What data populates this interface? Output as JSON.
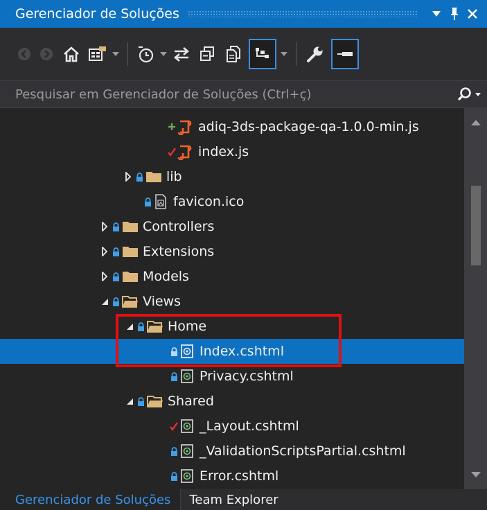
{
  "window": {
    "title": "Gerenciador de Soluções"
  },
  "search": {
    "placeholder": "Pesquisar em Gerenciador de Soluções (Ctrl+ç)"
  },
  "toolbar": {
    "icons": [
      "back-icon",
      "forward-icon",
      "home-icon",
      "switch-views-icon",
      "pending-changes-filter-icon",
      "sync-icon",
      "collapse-all-icon",
      "show-all-files-icon",
      "preview-selected-icon",
      "properties-icon",
      "pin-preview-icon"
    ]
  },
  "tree": {
    "items": [
      {
        "label": "adiq-3ds-package-qa-1.0.0-min.js",
        "type": "js",
        "status": "added"
      },
      {
        "label": "index.js",
        "type": "js",
        "status": "modified"
      },
      {
        "label": "lib",
        "type": "folder",
        "status": "locked",
        "expander": "collapsed"
      },
      {
        "label": "favicon.ico",
        "type": "ico",
        "status": "locked"
      },
      {
        "label": "Controllers",
        "type": "folder",
        "status": "locked",
        "expander": "collapsed"
      },
      {
        "label": "Extensions",
        "type": "folder",
        "status": "locked",
        "expander": "collapsed"
      },
      {
        "label": "Models",
        "type": "folder",
        "status": "locked",
        "expander": "collapsed"
      },
      {
        "label": "Views",
        "type": "folder-open",
        "status": "locked",
        "expander": "expanded"
      },
      {
        "label": "Home",
        "type": "folder-open",
        "status": "locked",
        "expander": "expanded"
      },
      {
        "label": "Index.cshtml",
        "type": "cshtml",
        "status": "locked",
        "selected": true
      },
      {
        "label": "Privacy.cshtml",
        "type": "cshtml",
        "status": "locked"
      },
      {
        "label": "Shared",
        "type": "folder-open",
        "status": "locked",
        "expander": "expanded"
      },
      {
        "label": "_Layout.cshtml",
        "type": "cshtml",
        "status": "modified"
      },
      {
        "label": "_ValidationScriptsPartial.cshtml",
        "type": "cshtml",
        "status": "locked"
      },
      {
        "label": "Error.cshtml",
        "type": "cshtml",
        "status": "locked"
      }
    ]
  },
  "tabs": [
    {
      "label": "Gerenciador de Soluções",
      "active": true
    },
    {
      "label": "Team Explorer",
      "active": false
    }
  ],
  "colors": {
    "accent": "#0e70c0",
    "folder": "#dcb67a",
    "js_file": "#f0622a",
    "added": "#6aa84f",
    "modified": "#e0312d",
    "highlight": "#e01010"
  }
}
